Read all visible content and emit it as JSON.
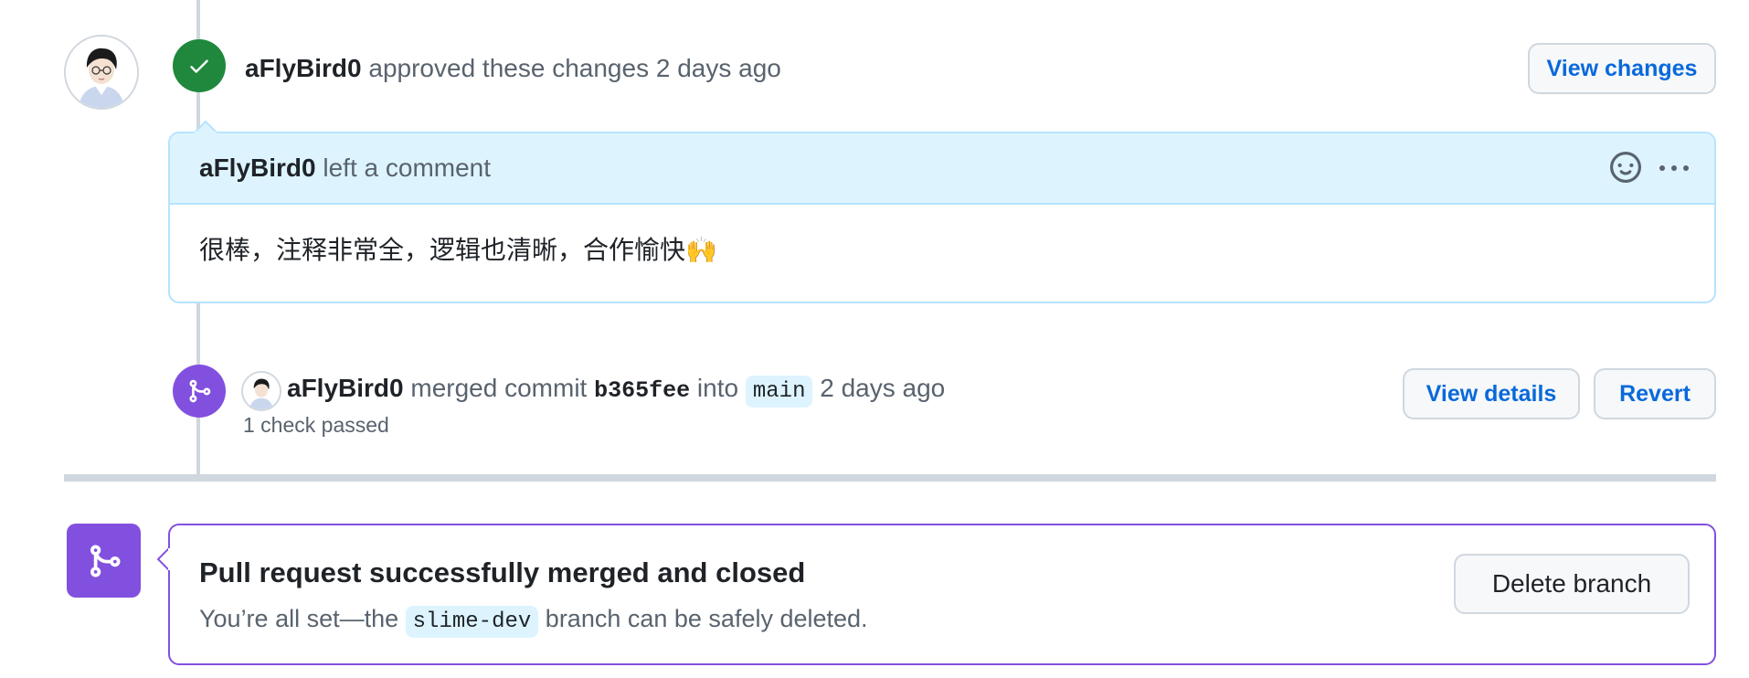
{
  "review": {
    "author": "aFlyBird0",
    "action": "approved these changes",
    "time": "2 days ago",
    "view_changes_label": "View changes"
  },
  "comment": {
    "author": "aFlyBird0",
    "action": "left a comment",
    "body": "很棒，注释非常全，逻辑也清晰，合作愉快🙌"
  },
  "merge_event": {
    "author": "aFlyBird0",
    "action": "merged commit",
    "commit": "b365fee",
    "into": "into",
    "branch": "main",
    "time": "2 days ago",
    "checks": "1 check passed",
    "view_details_label": "View details",
    "revert_label": "Revert"
  },
  "merged_status": {
    "title": "Pull request successfully merged and closed",
    "desc_prefix": "You’re all set—the",
    "branch": "slime-dev",
    "desc_suffix": "branch can be safely deleted.",
    "delete_label": "Delete branch"
  },
  "icons": {
    "approved": "check-icon",
    "merged": "git-merge-icon",
    "reaction": "smiley-icon",
    "more": "kebab-horizontal-icon"
  },
  "colors": {
    "approved_green": "#1f883d",
    "merged_purple": "#8250df",
    "link_blue": "#0969da",
    "comment_header_bg": "#ddf4ff"
  }
}
